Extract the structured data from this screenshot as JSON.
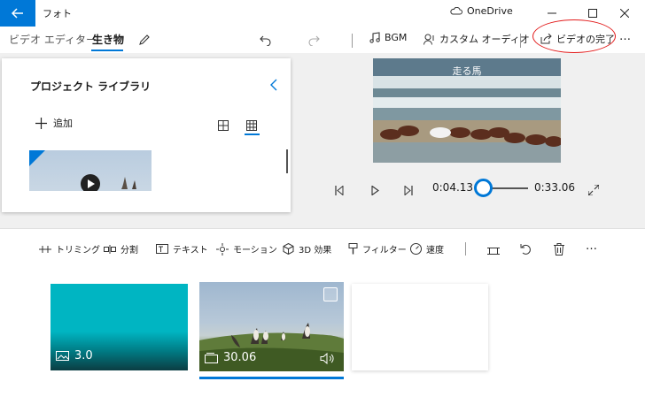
{
  "titlebar": {
    "back_icon": "arrow-left-icon",
    "app_title": "フォト",
    "onedrive_label": "OneDrive",
    "minimize_icon": "minimize-icon",
    "maximize_icon": "maximize-icon",
    "close_icon": "close-icon"
  },
  "toolbar": {
    "breadcrumb_root": "ビデオ エディター",
    "breadcrumb_current": "生き物",
    "undo_icon": "undo-icon",
    "redo_icon": "redo-icon",
    "bgm_label": "BGM",
    "custom_audio_label": "カスタム オーディオ",
    "finish_video_label": "ビデオの完了",
    "more_label": "…"
  },
  "library": {
    "title": "プロジェクト ライブラリ",
    "add_label": "追加"
  },
  "preview": {
    "caption": "走る馬"
  },
  "player": {
    "current_time": "0:04.13",
    "total_time": "0:33.06",
    "progress_fraction": 0.125
  },
  "storyboard": {
    "tools": [
      {
        "label": "トリミング"
      },
      {
        "label": "分割"
      },
      {
        "label": "テキスト"
      },
      {
        "label": "モーション"
      },
      {
        "label": "3D 効果"
      },
      {
        "label": "フィルター"
      },
      {
        "label": "速度"
      }
    ],
    "more_label": "…",
    "clips": [
      {
        "duration": "3.0"
      },
      {
        "duration": "30.06"
      }
    ]
  },
  "colors": {
    "accent": "#0078d7",
    "clip1": "#00b5c2",
    "annotation": "#e21b1b"
  }
}
